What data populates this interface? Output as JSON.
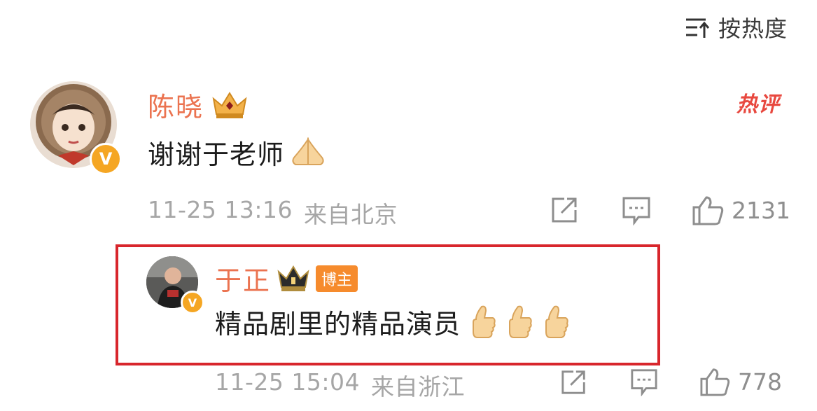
{
  "sort": {
    "label": "按热度"
  },
  "comment": {
    "username": "陈晓",
    "text": "谢谢于老师",
    "hot_tag": "热评",
    "date": "11-25 13:16",
    "location": "来自北京",
    "likes": "2131"
  },
  "reply": {
    "username": "于正",
    "blogger_tag": "博主",
    "text": "精品剧里的精品演员",
    "date": "11-25 15:04",
    "location": "来自浙江",
    "likes": "778"
  },
  "colors": {
    "username": "#eb7350",
    "highlight_border": "#d8262c",
    "verified_badge": "#f5a623",
    "blogger_tag": "#f68b2d"
  },
  "icons": [
    "sort-icon",
    "crown-icon",
    "verified-badge-icon",
    "folded-hands-emoji",
    "thumbs-up-emoji",
    "share-icon",
    "comment-icon",
    "like-icon"
  ]
}
